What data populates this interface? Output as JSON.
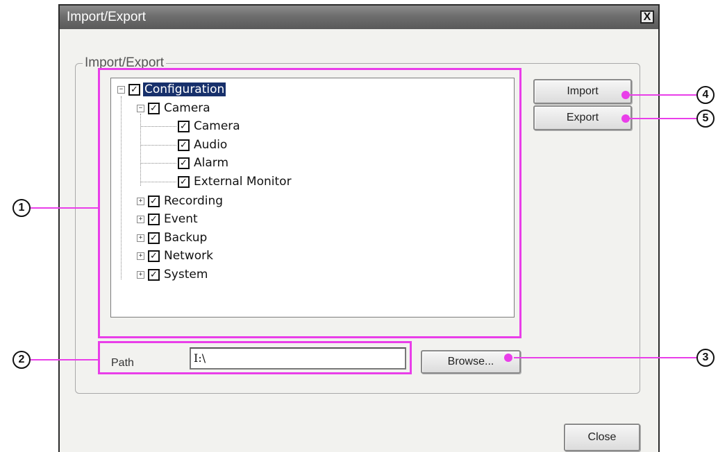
{
  "dialog": {
    "title": "Import/Export",
    "close_glyph": "X",
    "group_label": "Import/Export",
    "tree": {
      "root": {
        "label": "Configuration",
        "expander": "−",
        "check": "✓"
      },
      "camera": {
        "label": "Camera",
        "expander": "−",
        "check": "✓"
      },
      "camera_children": [
        {
          "label": "Camera",
          "check": "✓"
        },
        {
          "label": "Audio",
          "check": "✓"
        },
        {
          "label": "Alarm",
          "check": "✓"
        },
        {
          "label": "External Monitor",
          "check": "✓"
        }
      ],
      "others": [
        {
          "label": "Recording",
          "expander": "+",
          "check": "✓"
        },
        {
          "label": "Event",
          "expander": "+",
          "check": "✓"
        },
        {
          "label": "Backup",
          "expander": "+",
          "check": "✓"
        },
        {
          "label": "Network",
          "expander": "+",
          "check": "✓"
        },
        {
          "label": "System",
          "expander": "+",
          "check": "✓"
        }
      ]
    },
    "buttons": {
      "import": "Import",
      "export": "Export",
      "browse": "Browse...",
      "close": "Close"
    },
    "path": {
      "label": "Path",
      "value": "I:\\"
    }
  },
  "callouts": [
    "1",
    "2",
    "3",
    "4",
    "5"
  ],
  "colors": {
    "highlight": "#e93ee9",
    "selection": "#17306b",
    "titlebar": "#6d6d6d"
  }
}
